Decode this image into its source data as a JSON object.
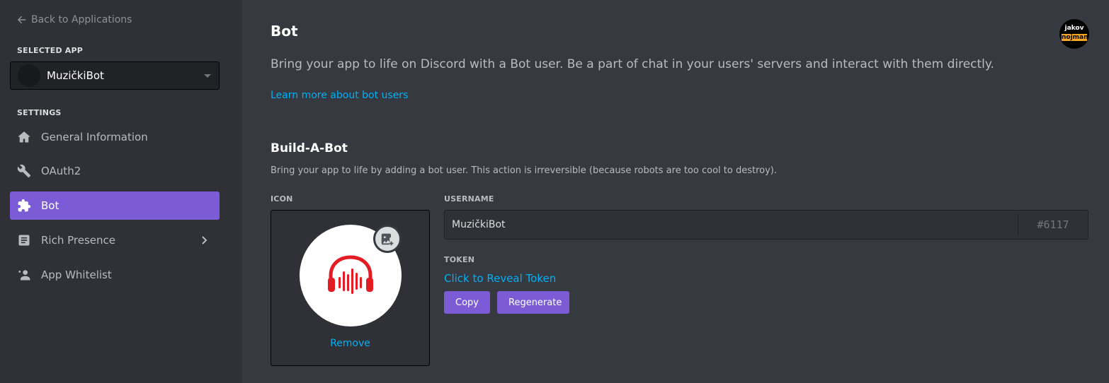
{
  "sidebar": {
    "back_label": "Back to Applications",
    "selected_app_label": "SELECTED APP",
    "selected_app": {
      "name": "MuzičkiBot"
    },
    "settings_label": "SETTINGS",
    "items": [
      {
        "label": "General Information",
        "icon": "home-icon"
      },
      {
        "label": "OAuth2",
        "icon": "wrench-icon"
      },
      {
        "label": "Bot",
        "icon": "puzzle-icon",
        "active": true
      },
      {
        "label": "Rich Presence",
        "icon": "document-icon",
        "has_submenu": true
      },
      {
        "label": "App Whitelist",
        "icon": "person-icon"
      }
    ],
    "accent_color": "#7b5cd6"
  },
  "header": {
    "title": "Bot",
    "description": "Bring your app to life on Discord with a Bot user. Be a part of chat in your users' servers and interact with them directly.",
    "learn_more": "Learn more about bot users",
    "user_avatar": {
      "line1": "jakov",
      "line2": "nojman"
    }
  },
  "build_a_bot": {
    "title": "Build-A-Bot",
    "description": "Bring your app to life by adding a bot user. This action is irreversible (because robots are too cool to destroy).",
    "icon_label": "ICON",
    "remove_label": "Remove",
    "username_label": "USERNAME",
    "username_value": "MuzičkiBot",
    "discriminator": "#6117",
    "token_label": "TOKEN",
    "reveal_token": "Click to Reveal Token",
    "copy_label": "Copy",
    "regenerate_label": "Regenerate",
    "bot_icon": "red-headphones-soundwave-icon",
    "bot_icon_color": "#e31b23"
  },
  "colors": {
    "link": "#00b0f4",
    "button": "#7b5cd6",
    "background": "#36393f",
    "sidebar": "#2f3136"
  }
}
